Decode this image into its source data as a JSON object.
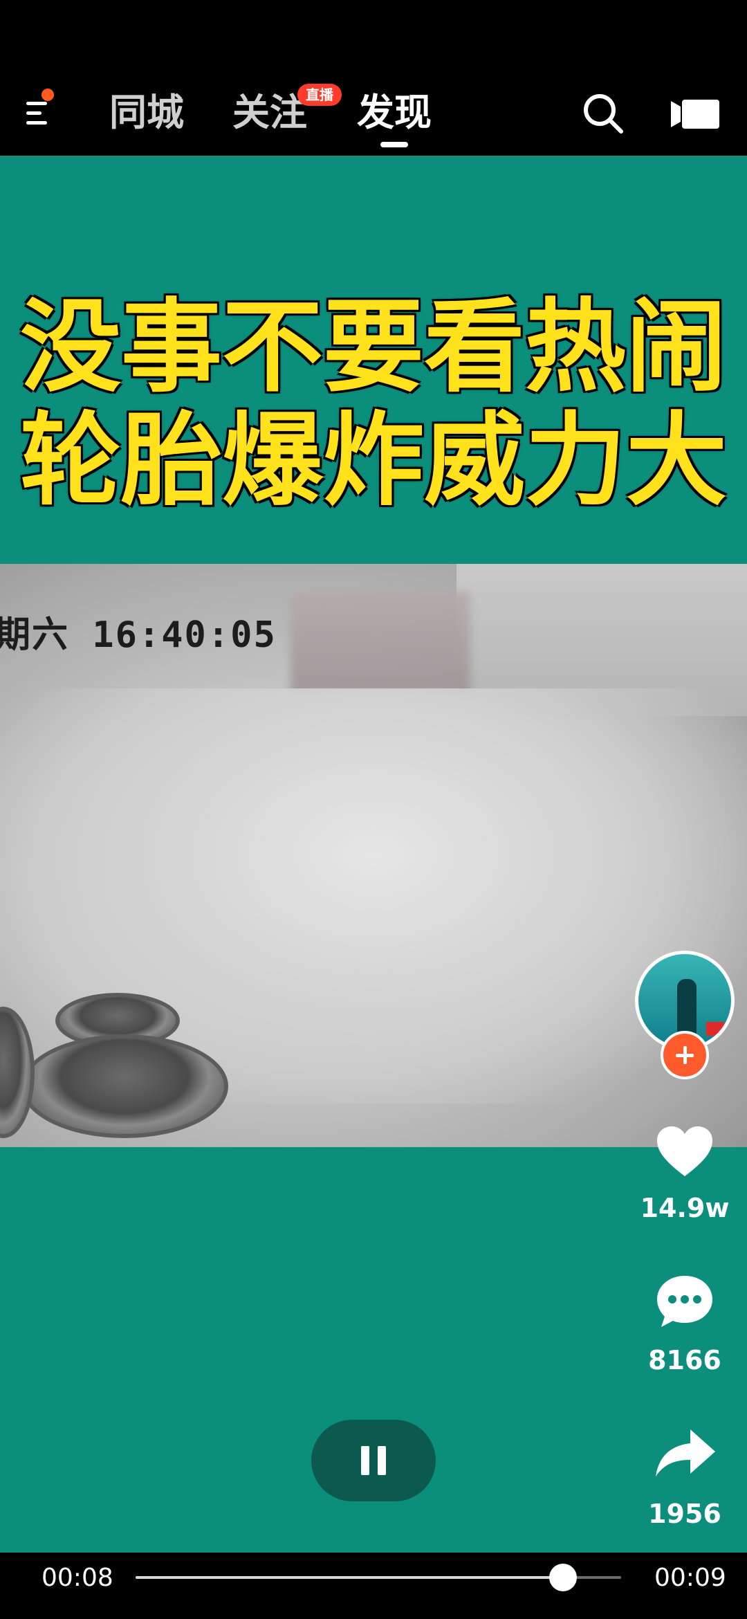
{
  "header": {
    "tabs": [
      {
        "label": "同城",
        "active": false
      },
      {
        "label": "关注",
        "active": false
      },
      {
        "label": "发现",
        "active": true
      }
    ],
    "live_badge": "直播",
    "icons": {
      "menu": "menu-icon",
      "search": "search-icon",
      "camera": "camera-icon"
    },
    "notification_dot_color": "#ff5a1f"
  },
  "video": {
    "headline_line1": "没事不要看热闹",
    "headline_line2": "轮胎爆炸威力大",
    "cctv_timestamp": "期六 16:40:05",
    "background_color": "#0b8f7c",
    "headline_color": "#ffe21b"
  },
  "actions": {
    "likes": "14.9w",
    "comments": "8166",
    "shares": "1956",
    "follow_accent": "#ff5a2c"
  },
  "player": {
    "elapsed": "00:08",
    "duration": "00:09",
    "progress_fraction": 0.88,
    "state": "playing"
  }
}
